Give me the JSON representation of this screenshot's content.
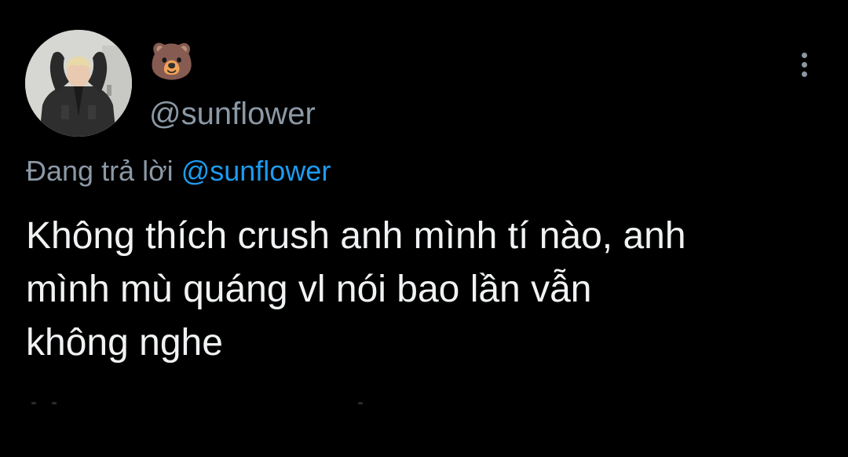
{
  "user": {
    "display_name": "🐻",
    "handle": "@sunflower"
  },
  "reply": {
    "prefix": "Đang trả lời",
    "mention": "@sunflower"
  },
  "tweet": {
    "lines": [
      "Không thích crush anh mình tí nào, anh",
      "mình mù quáng vl nói bao lần vẫn",
      "không nghe"
    ]
  },
  "icons": {
    "more": "more-vertical-icon",
    "avatar": "avatar-photo"
  },
  "colors": {
    "background": "#000000",
    "text": "#f0f2f3",
    "secondary": "#8b98a5",
    "accent": "#1d9bf0"
  }
}
